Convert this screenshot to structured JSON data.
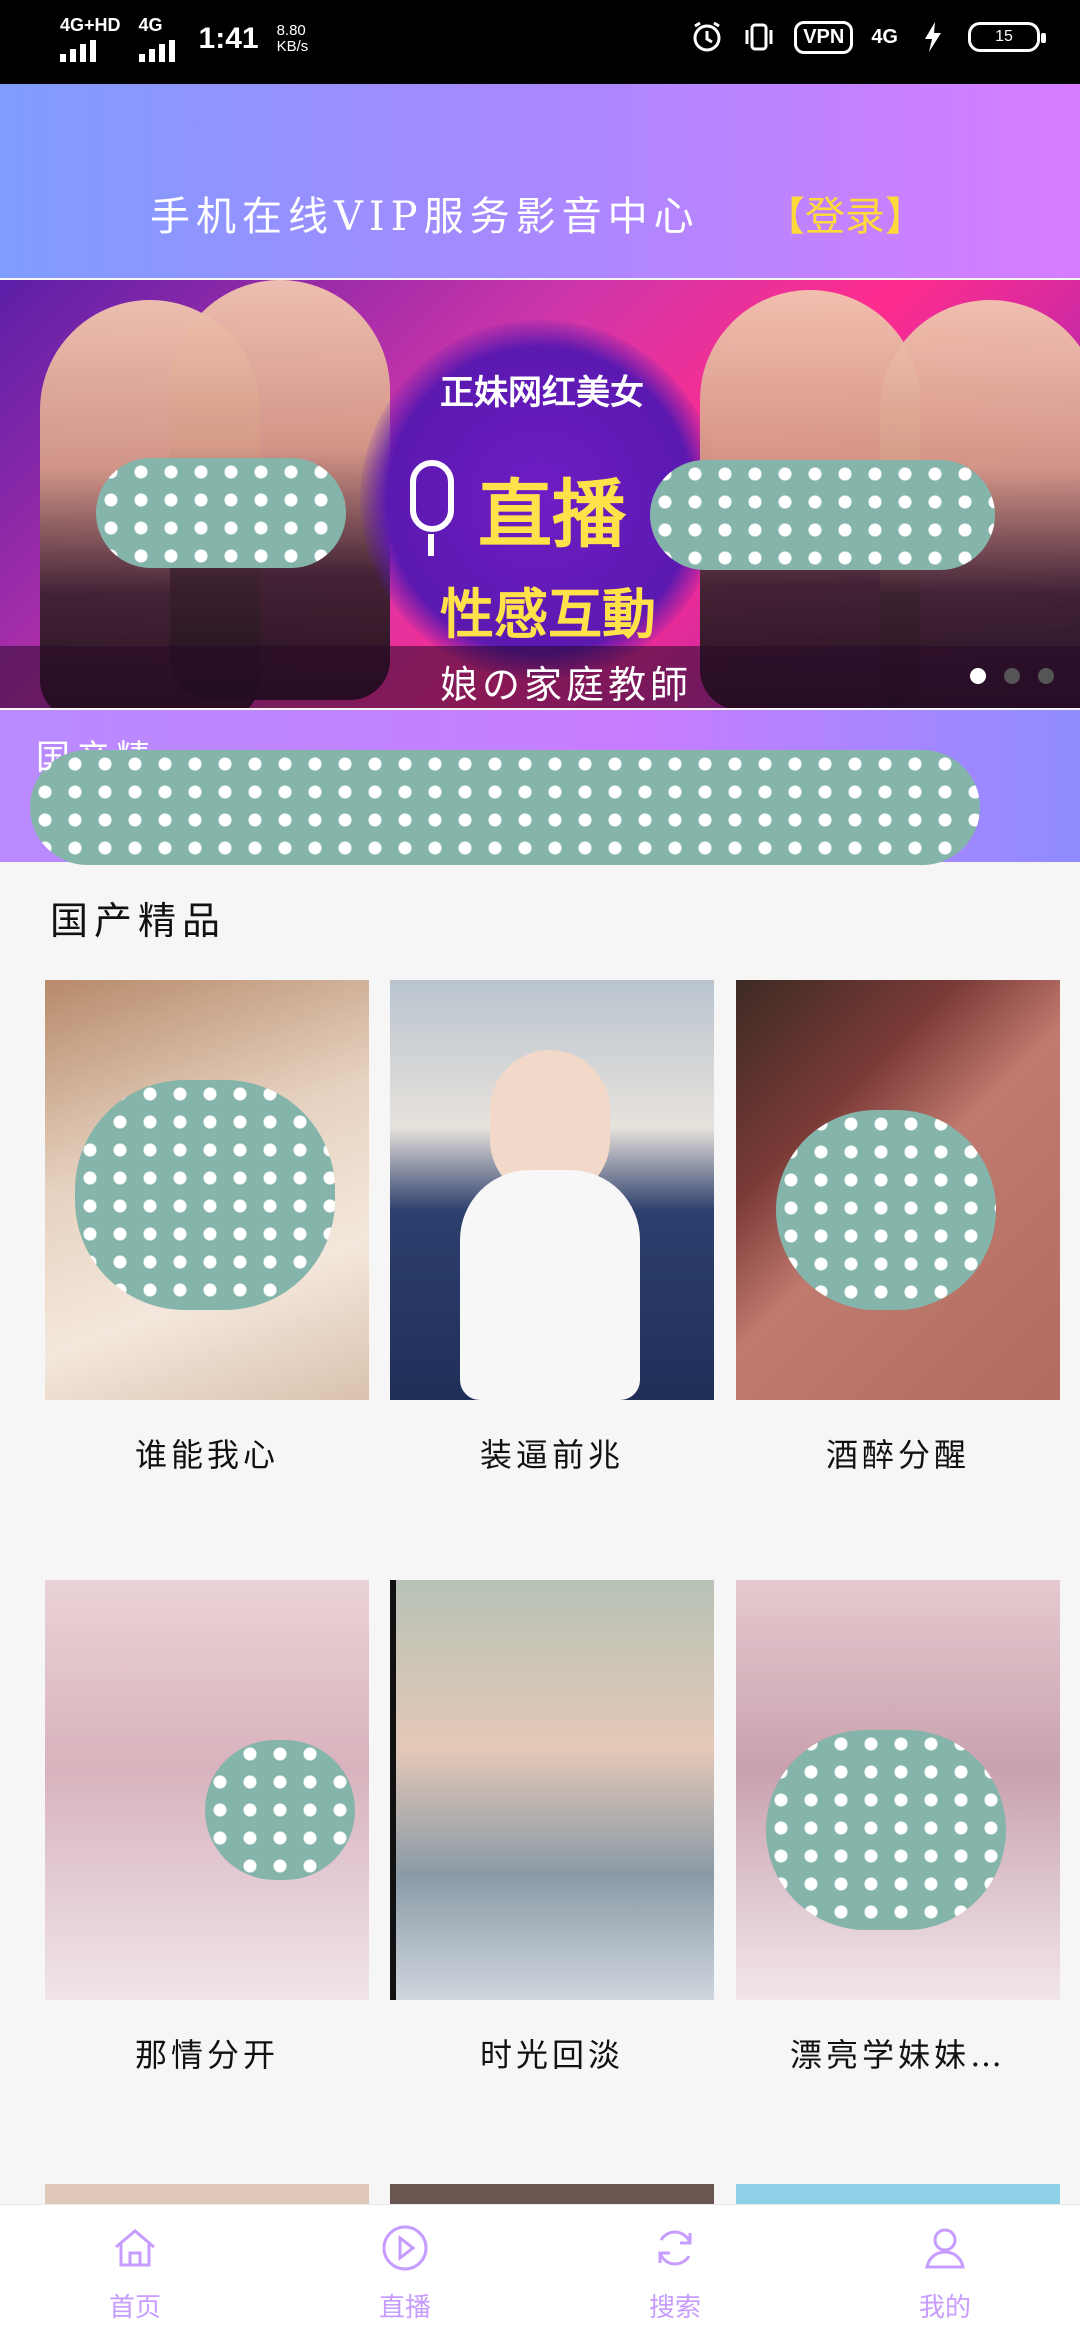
{
  "status_bar": {
    "network1": "4G+HD",
    "network2": "4G",
    "time": "1:41",
    "speed_value": "8.80",
    "speed_unit": "KB/s",
    "vpn": "VPN",
    "network_right": "4G",
    "battery": "15"
  },
  "header": {
    "title": "手机在线VIP服务影音中心",
    "login": "【登录】"
  },
  "banner": {
    "line1": "正妹网红美女",
    "line2": "直播",
    "line3": "性感互動",
    "caption": "娘の家庭教師",
    "dots_total": 3,
    "dots_active_index": 0
  },
  "marquee": {
    "text": "国产精"
  },
  "section": {
    "title": "国产精品",
    "cards": [
      {
        "title": "谁能我心"
      },
      {
        "title": "装逼前兆"
      },
      {
        "title": "酒醉分醒"
      },
      {
        "title": "那情分开"
      },
      {
        "title": "时光回淡"
      },
      {
        "title": "漂亮学妹妹…"
      }
    ]
  },
  "bottom_nav": {
    "items": [
      {
        "label": "首页",
        "icon": "home-icon"
      },
      {
        "label": "直播",
        "icon": "play-icon"
      },
      {
        "label": "搜索",
        "icon": "refresh-icon"
      },
      {
        "label": "我的",
        "icon": "user-icon"
      }
    ]
  },
  "colors": {
    "accent": "#c79cff",
    "login": "#ffd93a",
    "header_start": "#7f9cff",
    "header_end": "#d77dff"
  }
}
